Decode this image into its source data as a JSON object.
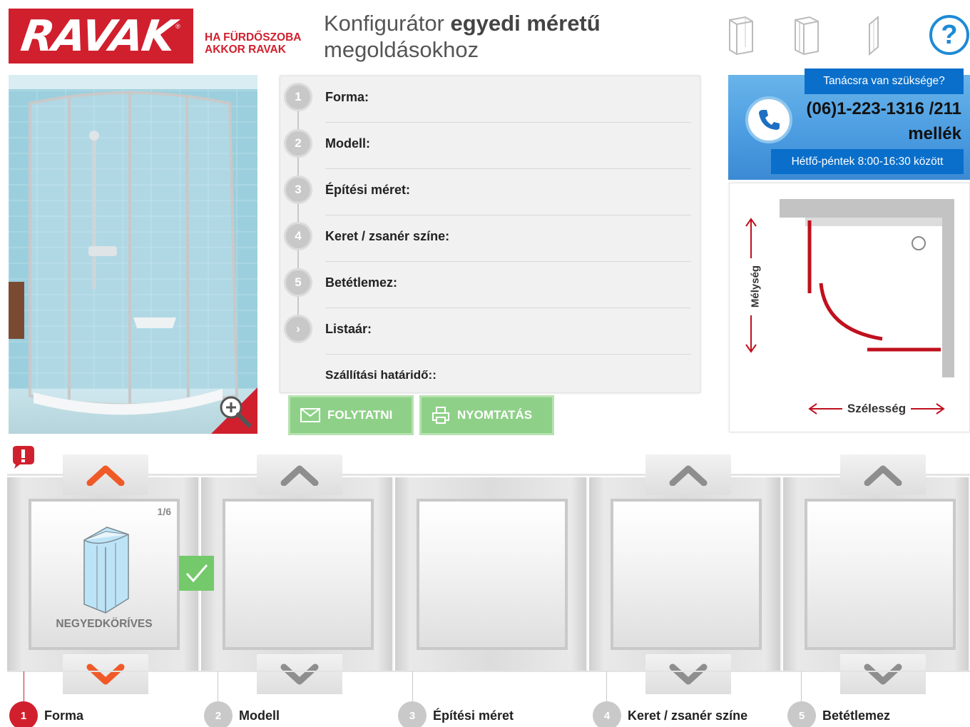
{
  "header": {
    "logo_text": "RAVAK",
    "logo_mark": "®",
    "slogan_line1": "HA FÜRDŐSZOBA",
    "slogan_line2": "AKKOR RAVAK",
    "title_normal": "Konfigurátor ",
    "title_bold": "egyedi méretű",
    "title_line2": "megoldásokhoz",
    "icons": [
      "shower-enclosure-icon",
      "shower-door-double-icon",
      "shower-panel-icon"
    ],
    "help_label": "?"
  },
  "summary": {
    "rows": [
      {
        "num": "1",
        "label": "Forma:"
      },
      {
        "num": "2",
        "label": "Modell:"
      },
      {
        "num": "3",
        "label": "Építési méret:"
      },
      {
        "num": "4",
        "label": "Keret / zsanér színe:"
      },
      {
        "num": "5",
        "label": "Betétlemez:"
      },
      {
        "num": "›",
        "label": "Listaár:"
      }
    ],
    "delivery_label": "Szállítási határidő::"
  },
  "buttons": {
    "continue": "FOLYTATNI",
    "print": "NYOMTATÁS"
  },
  "contact": {
    "title": "Tanácsra van szüksége?",
    "phone_line1": "(06)1-223-1316 /211",
    "phone_line2": "mellék",
    "hours": "Hétfő-péntek 8:00-16:30 között"
  },
  "diagram": {
    "depth_label": "Mélység",
    "width_label": "Szélesség"
  },
  "steps": {
    "forma_card": {
      "counter": "1/6",
      "label": "NEGYEDKÖRÍVES"
    },
    "labels": [
      {
        "num": "1",
        "label": "Forma"
      },
      {
        "num": "2",
        "label": "Modell"
      },
      {
        "num": "3",
        "label": "Építési méret"
      },
      {
        "num": "4",
        "label": "Keret / zsanér színe"
      },
      {
        "num": "5",
        "label": "Betétlemez"
      }
    ]
  },
  "colors": {
    "brand_red": "#d0202e",
    "accent_blue": "#0a6fcb",
    "button_green": "#8fd089",
    "arrow_orange": "#f05a28"
  }
}
